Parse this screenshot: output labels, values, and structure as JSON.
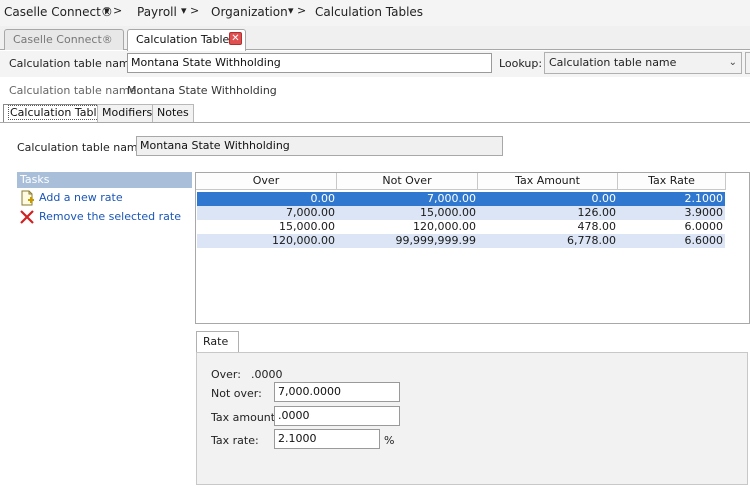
{
  "breadcrumb": {
    "items": [
      "Caselle Connect®",
      "Payroll",
      "Organization",
      "Calculation Tables"
    ],
    "separator": "▾ >"
  },
  "tabs": {
    "caselle": "Caselle Connect®",
    "calc_tables": "Calculation Tables",
    "close_glyph": "✕"
  },
  "topbar": {
    "name_label": "Calculation table name:",
    "name_value": "Montana State Withholding",
    "lookup_label": "Lookup:",
    "lookup_value": "Calculation table name"
  },
  "info": {
    "label": "Calculation table name:",
    "value": "Montana State Withholding"
  },
  "subtabs": [
    "Calculation Table",
    "Modifiers",
    "Notes"
  ],
  "detail": {
    "name_label": "Calculation table name:",
    "name_value": "Montana State Withholding"
  },
  "tasks": {
    "title": "Tasks",
    "add": "Add a new rate",
    "remove": "Remove the selected rate"
  },
  "grid": {
    "headers": [
      "Over",
      "Not Over",
      "Tax Amount",
      "Tax Rate"
    ],
    "rows": [
      [
        "0.00",
        "7,000.00",
        "0.00",
        "2.1000"
      ],
      [
        "7,000.00",
        "15,000.00",
        "126.00",
        "3.9000"
      ],
      [
        "15,000.00",
        "120,000.00",
        "478.00",
        "6.0000"
      ],
      [
        "120,000.00",
        "99,999,999.99",
        "6,778.00",
        "6.6000"
      ]
    ],
    "selected_row": 0,
    "colors": {
      "selected": "#3078cf",
      "alt": "#dbe5f5"
    }
  },
  "rate": {
    "tab": "Rate",
    "over_label": "Over:",
    "over_value": ".0000",
    "notover_label": "Not over:",
    "notover_value": "7,000.0000",
    "taxamount_label": "Tax amount:",
    "taxamount_value": ".0000",
    "taxrate_label": "Tax rate:",
    "taxrate_value": "2.1000",
    "percent": "%"
  }
}
